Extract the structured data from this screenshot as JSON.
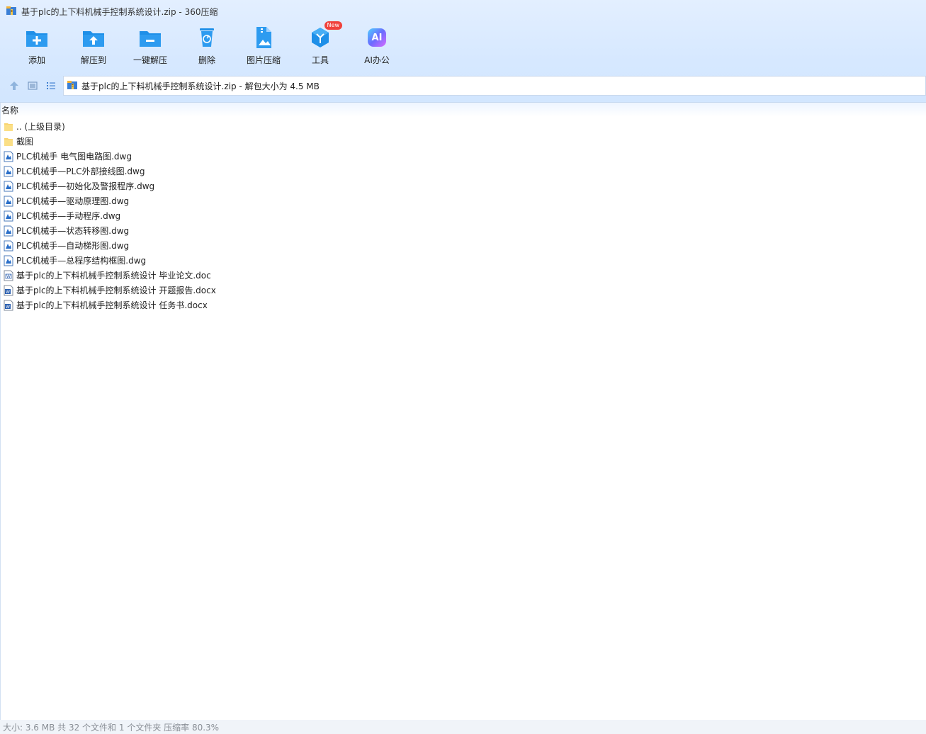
{
  "window": {
    "title": "基于plc的上下料机械手控制系统设计.zip - 360压缩"
  },
  "toolbar": {
    "buttons": [
      {
        "label": "添加",
        "icon": "add-folder-icon"
      },
      {
        "label": "解压到",
        "icon": "extract-to-icon"
      },
      {
        "label": "一键解压",
        "icon": "one-click-extract-icon"
      },
      {
        "label": "删除",
        "icon": "delete-icon"
      },
      {
        "label": "图片压缩",
        "icon": "image-compress-icon"
      },
      {
        "label": "工具",
        "icon": "tools-icon",
        "badge": "New"
      },
      {
        "label": "AI办公",
        "icon": "ai-office-icon",
        "icon_text": "AI"
      }
    ]
  },
  "address_bar": {
    "text": "基于plc的上下料机械手控制系统设计.zip - 解包大小为 4.5 MB"
  },
  "list_header": {
    "name_col": "名称"
  },
  "files": [
    {
      "name": ".. (上级目录)",
      "type": "folder"
    },
    {
      "name": "截图",
      "type": "folder"
    },
    {
      "name": "PLC机械手 电气图电路图.dwg",
      "type": "dwg"
    },
    {
      "name": "PLC机械手—PLC外部接线图.dwg",
      "type": "dwg"
    },
    {
      "name": "PLC机械手—初始化及警报程序.dwg",
      "type": "dwg"
    },
    {
      "name": "PLC机械手—驱动原理图.dwg",
      "type": "dwg"
    },
    {
      "name": "PLC机械手—手动程序.dwg",
      "type": "dwg"
    },
    {
      "name": "PLC机械手—状态转移图.dwg",
      "type": "dwg"
    },
    {
      "name": "PLC机械手—自动梯形图.dwg",
      "type": "dwg"
    },
    {
      "name": "PLC机械手—总程序结构框图.dwg",
      "type": "dwg"
    },
    {
      "name": "基于plc的上下料机械手控制系统设计 毕业论文.doc",
      "type": "doc"
    },
    {
      "name": "基于plc的上下料机械手控制系统设计 开题报告.docx",
      "type": "docx"
    },
    {
      "name": "基于plc的上下料机械手控制系统设计 任务书.docx",
      "type": "docx"
    }
  ],
  "status": {
    "text": "大小: 3.6 MB 共 32 个文件和 1 个文件夹 压缩率 80.3%"
  },
  "colors": {
    "accent": "#1e8fe8",
    "chrome_bg": "#d6e8ff",
    "badge": "#f0413b"
  }
}
